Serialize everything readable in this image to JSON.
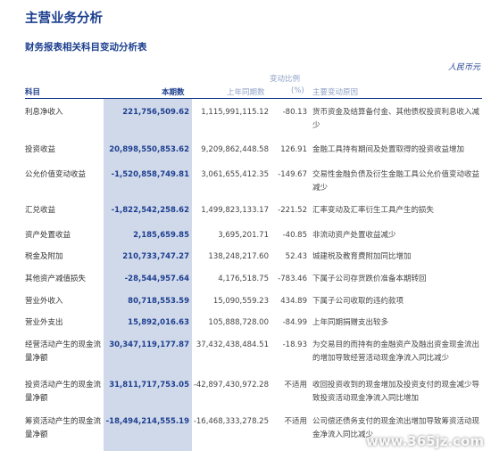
{
  "title": "主营业务分析",
  "subtitle": "财务报表相关科目变动分析表",
  "unit": "人民币元",
  "headers": {
    "item": "科目",
    "current": "本期数",
    "previous": "上年同期数",
    "pct_line1": "变动比例",
    "pct_line2": "(%)",
    "reason": "主要变动原因"
  },
  "rows": [
    {
      "item": "利息净收入",
      "current": "221,756,509.62",
      "previous": "1,115,991,115.12",
      "pct": "-80.13",
      "reason": "货币资金及结算备付金、其他债权投资利息收入减少"
    },
    {
      "item": "投资收益",
      "current": "20,898,550,853.62",
      "previous": "9,209,862,448.58",
      "pct": "126.91",
      "reason": "金融工具持有期间及处置取得的投资收益增加"
    },
    {
      "item": "公允价值变动收益",
      "current": "-1,520,858,749.81",
      "previous": "3,061,655,412.35",
      "pct": "-149.67",
      "reason": "交易性金融负债及衍生金融工具公允价值变动收益减少"
    },
    {
      "item": "汇兑收益",
      "current": "-1,822,542,258.62",
      "previous": "1,499,823,133.17",
      "pct": "-221.52",
      "reason": "汇率变动及汇率衍生工具产生的损失"
    },
    {
      "item": "资产处置收益",
      "current": "2,185,659.85",
      "previous": "3,695,201.71",
      "pct": "-40.85",
      "reason": "非流动资产处置收益减少"
    },
    {
      "item": "税金及附加",
      "current": "210,733,747.27",
      "previous": "138,248,217.60",
      "pct": "52.43",
      "reason": "城建税及教育费附加同比增加"
    },
    {
      "item": "其他资产减值损失",
      "current": "-28,544,957.64",
      "previous": "4,176,518.75",
      "pct": "-783.46",
      "reason": "下属子公司存货跌价准备本期转回"
    },
    {
      "item": "营业外收入",
      "current": "80,718,553.59",
      "previous": "15,090,559.23",
      "pct": "434.89",
      "reason": "下属子公司收取的违约款项"
    },
    {
      "item": "营业外支出",
      "current": "15,892,016.63",
      "previous": "105,888,728.00",
      "pct": "-84.99",
      "reason": "上年同期捐赠支出较多"
    },
    {
      "item": "经营活动产生的现金流量净额",
      "current": "30,347,119,177.87",
      "previous": "37,432,438,484.51",
      "pct": "-18.93",
      "reason": "为交易目的而持有的金融资产及融出资金现金流出的增加导致经营活动现金净流入同比减少"
    },
    {
      "item": "投资活动产生的现金流量净额",
      "current": "31,811,717,753.05",
      "previous": "-42,897,430,972.28",
      "pct": "不适用",
      "reason": "收回投资收到的现金增加及投资支付的现金减少导致投资活动现金净流入同比增加"
    },
    {
      "item": "筹资活动产生的现金流量净额",
      "current": "-18,494,214,555.19",
      "previous": "-16,468,333,278.25",
      "pct": "不适用",
      "reason": "公司偿还债务支付的现金流出增加导致筹资活动现金净流入同比减少"
    }
  ],
  "watermark": "www.365jz.com",
  "colors": {
    "accent": "#1d3f8f",
    "column_shade": "#d0d9ea"
  }
}
